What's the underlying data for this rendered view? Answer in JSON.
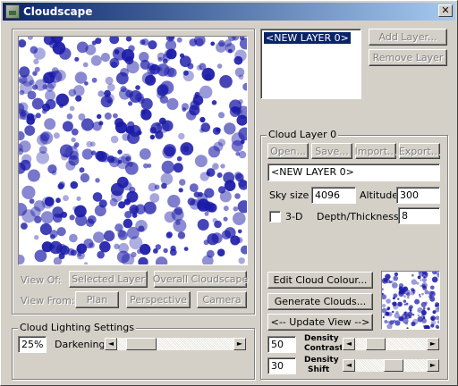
{
  "window": {
    "title": "Cloudscape",
    "close_label": "✕"
  },
  "preview_left": {
    "caption": ""
  },
  "view_of": {
    "label": "View Of:",
    "selected_layer": "Selected Layer",
    "overall": "Overall Cloudscape"
  },
  "view_from": {
    "label": "View From:",
    "plan": "Plan",
    "perspective": "Perspective",
    "camera": "Camera"
  },
  "lighting": {
    "title": "Cloud Lighting Settings",
    "value": "25%",
    "label": "Darkening",
    "level": 0.1
  },
  "layers": {
    "items": [
      "<NEW LAYER 0>"
    ],
    "add": "Add Layer...",
    "remove": "Remove Layer"
  },
  "cloud_layer": {
    "title": "Cloud Layer 0",
    "open": "Open...",
    "save": "Save...",
    "import": "Import...",
    "export": "Export...",
    "name": "<NEW LAYER 0>",
    "sky_size_label": "Sky size",
    "sky_size": "4096",
    "altitude_label": "Altitude",
    "altitude": "300",
    "three_d_label": "3-D",
    "depth_label": "Depth/Thickness",
    "depth": "8",
    "edit_colour": "Edit Cloud Colour...",
    "generate": "Generate Clouds...",
    "update_view": "<-- Update View -->",
    "density_contrast_value": "50",
    "density_contrast_label_1": "Density",
    "density_contrast_label_2": "Contrast",
    "density_contrast_level": 0.2,
    "density_shift_value": "30",
    "density_shift_label_1": "Density",
    "density_shift_label_2": "Shift",
    "density_shift_level": 0.55
  },
  "colors": {
    "cloud_blue": "#1a1aa8",
    "title_start": "#0a246a",
    "title_end": "#a6caf0"
  },
  "icons": {
    "arrow_left": "◄",
    "arrow_right": "►"
  }
}
